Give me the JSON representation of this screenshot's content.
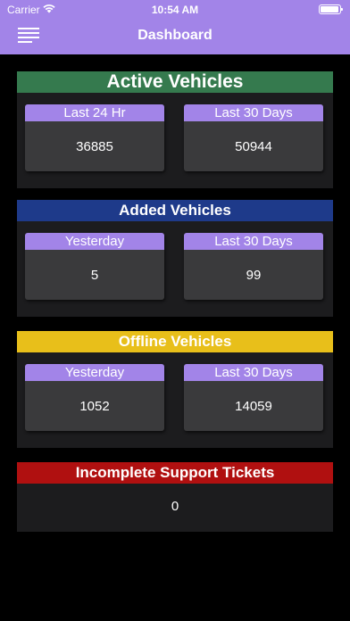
{
  "status_bar": {
    "carrier": "Carrier",
    "time": "10:54 AM"
  },
  "nav": {
    "title": "Dashboard",
    "menu_icon": "hamburger-menu-icon"
  },
  "colors": {
    "header": "#a284e8",
    "active": "#357a4e",
    "added": "#1e3a8a",
    "offline": "#e8bf1a",
    "support": "#b01010",
    "tile_label": "#a284e8",
    "tile_bg": "#3a3a3c",
    "card_bg": "#1c1c1e"
  },
  "cards": {
    "active": {
      "title": "Active Vehicles",
      "tiles": [
        {
          "label": "Last 24 Hr",
          "value": "36885"
        },
        {
          "label": "Last 30 Days",
          "value": "50944"
        }
      ]
    },
    "added": {
      "title": "Added Vehicles",
      "tiles": [
        {
          "label": "Yesterday",
          "value": "5"
        },
        {
          "label": "Last 30 Days",
          "value": "99"
        }
      ]
    },
    "offline": {
      "title": "Offline Vehicles",
      "tiles": [
        {
          "label": "Yesterday",
          "value": "1052"
        },
        {
          "label": "Last 30 Days",
          "value": "14059"
        }
      ]
    },
    "support": {
      "title": "Incomplete Support Tickets",
      "value": "0"
    }
  }
}
